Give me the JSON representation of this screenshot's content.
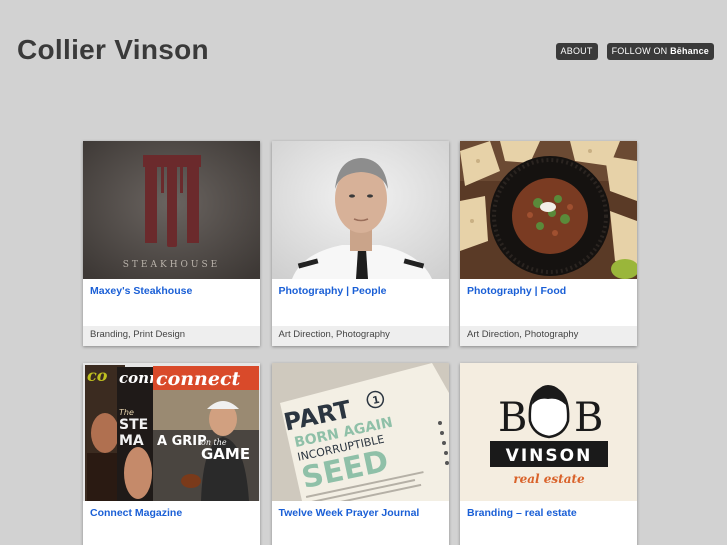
{
  "header": {
    "title": "Collier Vinson",
    "about_label": "ABOUT",
    "follow_label": "FOLLOW ON",
    "follow_brand": "Bēhance"
  },
  "projects": [
    {
      "title": "Maxey's Steakhouse",
      "tags": "Branding, Print Design",
      "thumb_text": "STEAKHOUSE"
    },
    {
      "title": "Photography | People",
      "tags": "Art Direction, Photography"
    },
    {
      "title": "Photography | Food",
      "tags": "Art Direction, Photography"
    },
    {
      "title": "Connect Magazine",
      "tags": "",
      "thumb_text": [
        "connect",
        "conn",
        "The",
        "STE",
        "MA",
        "A GRIP",
        "on the",
        "GAME"
      ]
    },
    {
      "title": "Twelve Week Prayer Journal",
      "tags": "",
      "thumb_text": [
        "PART",
        "1",
        "BORN AGAIN",
        "INCORRUPTIBLE",
        "SEED",
        "D"
      ]
    },
    {
      "title": "Branding – real estate",
      "tags": "",
      "thumb_text": [
        "B",
        "B",
        "VINSON",
        "real estate"
      ]
    }
  ],
  "colors": {
    "background": "#d2d2d2",
    "title_text": "#3a3a3a",
    "nav_button": "#3a3a3a",
    "link_blue": "#1a5fd6",
    "tag_bar": "#eeeeee"
  }
}
